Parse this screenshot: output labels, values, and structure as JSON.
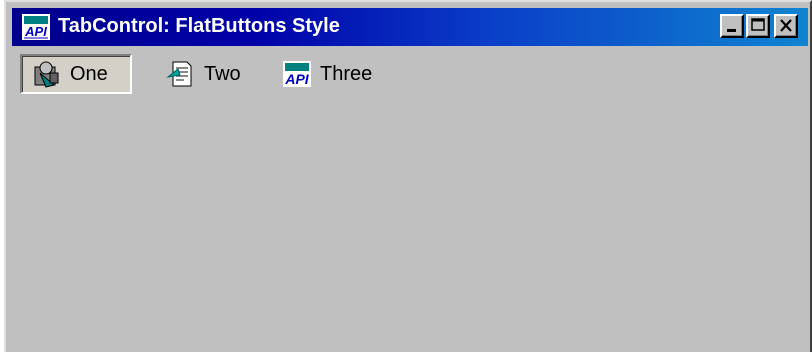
{
  "window": {
    "title": "TabControl: FlatButtons Style",
    "icon": "api-viewer-icon",
    "title_icon_text": "API"
  },
  "caption_buttons": {
    "minimize": "minimize-icon",
    "maximize": "maximize-icon",
    "close": "close-icon"
  },
  "tabs": [
    {
      "label": "One",
      "icon": "user-tool-icon",
      "selected": true
    },
    {
      "label": "Two",
      "icon": "document-icon",
      "selected": false
    },
    {
      "label": "Three",
      "icon": "api-viewer-icon",
      "selected": false
    }
  ],
  "colors": {
    "titlebar_start": "#00008c",
    "titlebar_end": "#1084d0",
    "face": "#c0c0c0"
  }
}
